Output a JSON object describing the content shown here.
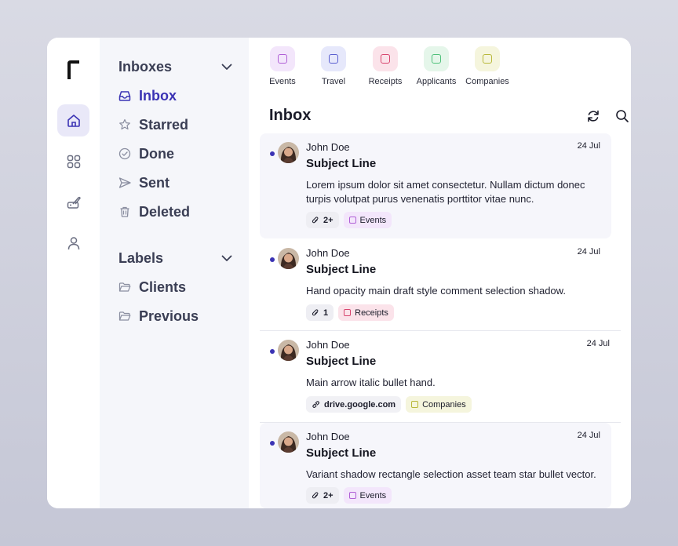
{
  "colors": {
    "accent": "#3b33b4",
    "sidebar_bg": "#f5f6fa",
    "events": "#b05fd6",
    "travel": "#5a5fd0",
    "receipts": "#d8466f",
    "applicants": "#4fc07a",
    "companies": "#b8b83a"
  },
  "rail": {
    "items": [
      {
        "icon": "home-icon"
      },
      {
        "icon": "grid-icon"
      },
      {
        "icon": "brush-icon"
      },
      {
        "icon": "user-icon"
      }
    ]
  },
  "sidebar": {
    "inboxes_title": "Inboxes",
    "inboxes": [
      {
        "label": "Inbox",
        "icon": "inbox-icon"
      },
      {
        "label": "Starred",
        "icon": "star-icon"
      },
      {
        "label": "Done",
        "icon": "check-circle-icon"
      },
      {
        "label": "Sent",
        "icon": "send-icon"
      },
      {
        "label": "Deleted",
        "icon": "trash-icon"
      }
    ],
    "labels_title": "Labels",
    "labels": [
      {
        "label": "Clients",
        "icon": "folder-icon"
      },
      {
        "label": "Previous",
        "icon": "folder-icon"
      }
    ]
  },
  "categories": [
    {
      "label": "Events"
    },
    {
      "label": "Travel"
    },
    {
      "label": "Receipts"
    },
    {
      "label": "Applicants"
    },
    {
      "label": "Companies"
    }
  ],
  "main": {
    "title": "Inbox",
    "toolbar": {
      "refresh": "refresh-icon",
      "search": "search-icon",
      "compose": "compose-icon"
    }
  },
  "emails": [
    {
      "sender": "John Doe",
      "date": "24 Jul",
      "subject": "Subject Line",
      "body": "Lorem ipsum dolor sit amet consectetur. Nullam dictum donec turpis volutpat purus venenatis porttitor vitae nunc.",
      "chip1": "2+",
      "chip2": "Events"
    },
    {
      "sender": "John Doe",
      "date": "24 Jul",
      "subject": "Subject Line",
      "body": "Hand opacity main draft style comment selection shadow.",
      "chip1": "1",
      "chip2": "Receipts"
    },
    {
      "sender": "John Doe",
      "date": "24 Jul",
      "subject": "Subject Line",
      "body": "Main arrow italic bullet hand.",
      "chip1": "drive.google.com",
      "chip2": "Companies"
    },
    {
      "sender": "John Doe",
      "date": "24 Jul",
      "subject": "Subject Line",
      "body": "Variant shadow rectangle selection asset team star bullet vector.",
      "chip1": "2+",
      "chip2": "Events"
    }
  ]
}
